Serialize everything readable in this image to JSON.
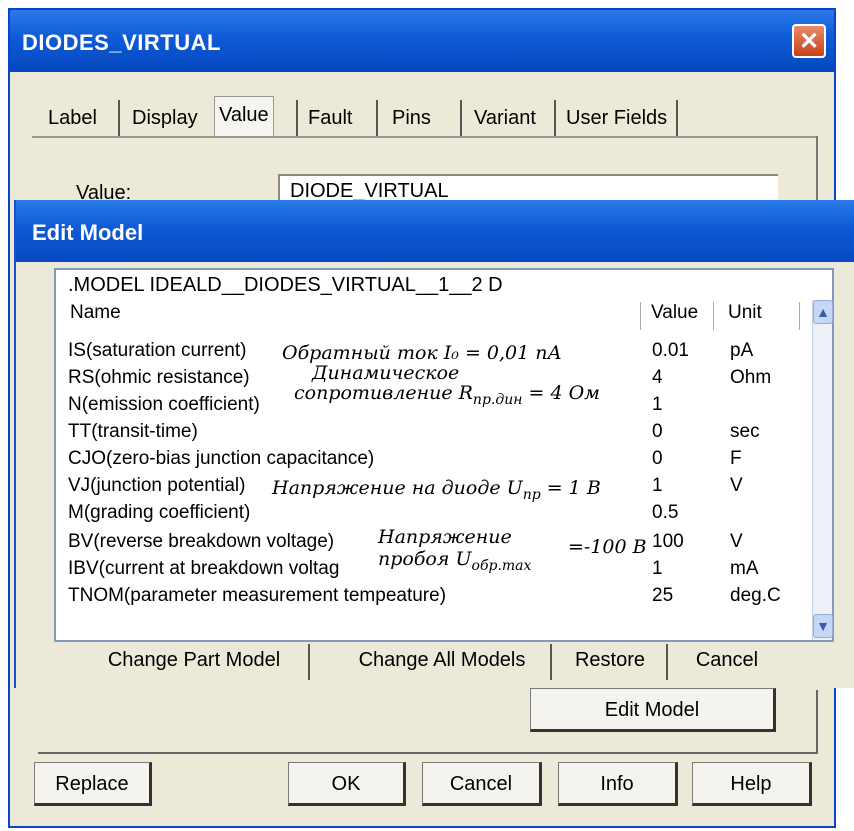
{
  "window": {
    "title": "DIODES_VIRTUAL",
    "close_glyph": "✕"
  },
  "tabs": [
    "Label",
    "Display",
    "Value",
    "Fault",
    "Pins",
    "Variant",
    "User Fields"
  ],
  "value_field": {
    "label": "Value:",
    "value": "DIODE_VIRTUAL"
  },
  "edit_model": {
    "title": "Edit Model",
    "model_line": ".MODEL IDEALD__DIODES_VIRTUAL__1__2  D",
    "headers": {
      "name": "Name",
      "value": "Value",
      "unit": "Unit"
    },
    "rows": [
      {
        "name": "IS(saturation current)",
        "value": "0.01",
        "unit": "pA"
      },
      {
        "name": "RS(ohmic resistance)",
        "value": "4",
        "unit": "Ohm"
      },
      {
        "name": "N(emission coefficient)",
        "value": "1",
        "unit": ""
      },
      {
        "name": "TT(transit-time)",
        "value": "0",
        "unit": "sec"
      },
      {
        "name": "CJO(zero-bias junction capacitance)",
        "value": "0",
        "unit": "F"
      },
      {
        "name": "VJ(junction potential)",
        "value": "1",
        "unit": "V"
      },
      {
        "name": "M(grading coefficient)",
        "value": "0.5",
        "unit": ""
      },
      {
        "name": "BV(reverse breakdown voltage)",
        "value": "100",
        "unit": "V"
      },
      {
        "name": "IBV(current at breakdown voltag",
        "value": "1",
        "unit": "mA"
      },
      {
        "name": "TNOM(parameter measurement tempeature)",
        "value": "25",
        "unit": "deg.C"
      }
    ],
    "notes": {
      "is": "Обратный ток I₀ = 0,01 пА",
      "rs_1": "Динамическое",
      "rs_2": "сопротивление R",
      "rs_sub": "пр.дин",
      "rs_tail": " = 4 Ом",
      "vj": "Напряжение  на диоде U",
      "vj_sub": "пр",
      "vj_tail": " = 1 В",
      "bv_1": "Напряжение",
      "bv_2": "пробоя U",
      "bv_sub": "обр.max",
      "bv_tail": "=-100 В"
    },
    "buttons": {
      "change_part": "Change Part Model",
      "change_all": "Change All Models",
      "restore": "Restore",
      "cancel": "Cancel"
    },
    "scroll": {
      "up": "▲",
      "down": "▼"
    }
  },
  "buttons": {
    "edit_model": "Edit Model",
    "replace": "Replace",
    "ok": "OK",
    "cancel": "Cancel",
    "info": "Info",
    "help": "Help"
  }
}
